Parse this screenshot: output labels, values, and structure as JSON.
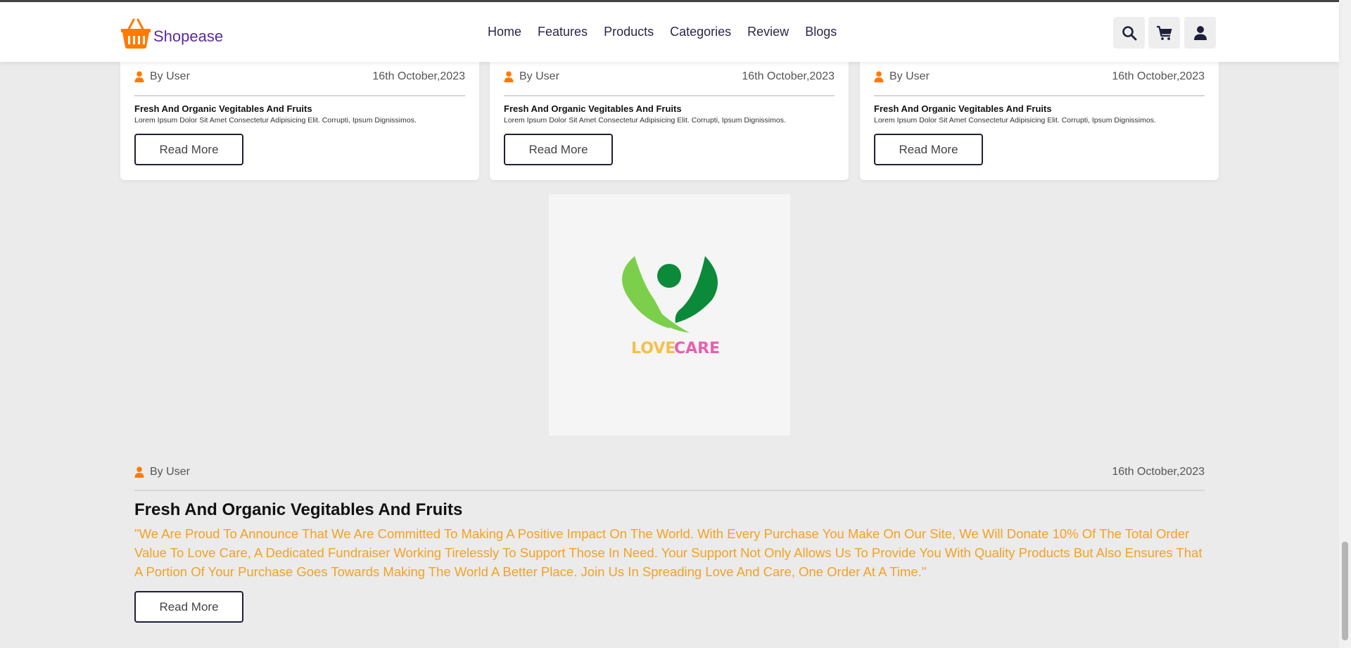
{
  "header": {
    "brand": "Shopease",
    "nav": [
      "Home",
      "Features",
      "Products",
      "Categories",
      "Review",
      "Blogs"
    ]
  },
  "cards": [
    {
      "author": "By User",
      "date": "16th October,2023",
      "title": "Fresh And Organic Vegitables And Fruits",
      "desc": "Lorem Ipsum Dolor Sit Amet Consectetur Adipisicing Elit. Corrupti, Ipsum Dignissimos.",
      "button": "Read More"
    },
    {
      "author": "By User",
      "date": "16th October,2023",
      "title": "Fresh And Organic Vegitables And Fruits",
      "desc": "Lorem Ipsum Dolor Sit Amet Consectetur Adipisicing Elit. Corrupti, Ipsum Dignissimos.",
      "button": "Read More"
    },
    {
      "author": "By User",
      "date": "16th October,2023",
      "title": "Fresh And Organic Vegitables And Fruits",
      "desc": "Lorem Ipsum Dolor Sit Amet Consectetur Adipisicing Elit. Corrupti, Ipsum Dignissimos.",
      "button": "Read More"
    }
  ],
  "featured": {
    "logo_text_1": "LOVE",
    "logo_text_2": "CARE",
    "author": "By User",
    "date": "16th October,2023",
    "title": "Fresh And Organic Vegitables And Fruits",
    "desc": "\"We Are Proud To Announce That We Are Committed To Making A Positive Impact On The World. With Every Purchase You Make On Our Site, We Will Donate 10% Of The Total Order Value To Love Care, A Dedicated Fundraiser Working Tirelessly To Support Those In Need. Your Support Not Only Allows Us To Provide You With Quality Products But Also Ensures That A Portion Of Your Purchase Goes Towards Making The World A Better Place. Join Us In Spreading Love And Care, One Order At A Time.\"",
    "button": "Read More"
  },
  "colors": {
    "accent": "#ff7a00",
    "brand_purple": "#5b2a9e",
    "highlight_text": "#f5a122",
    "logo_green_light": "#7ccf4b",
    "logo_green_dark": "#0b8a3a",
    "logo_yellow": "#f5c04a",
    "logo_pink": "#e85fb0"
  },
  "icons": [
    "basket-icon",
    "search-icon",
    "cart-icon",
    "user-icon"
  ]
}
